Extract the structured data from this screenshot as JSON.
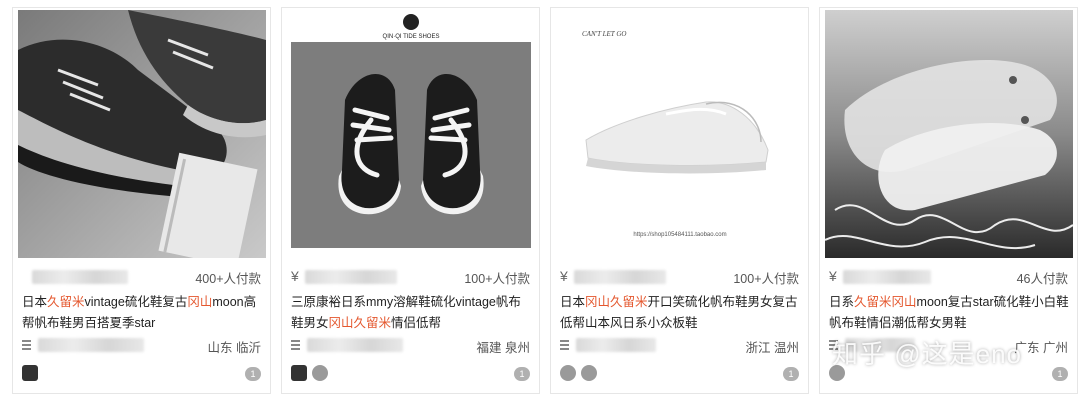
{
  "products": [
    {
      "title_parts": [
        "日本",
        "久留米",
        "vintage硫化鞋复古",
        "冈山",
        "moon高帮帆布鞋男百搭夏季star"
      ],
      "highlight": [
        false,
        true,
        false,
        true,
        false
      ],
      "show_yen": false,
      "sales": "400+人付款",
      "location": "山东 临沂",
      "comment_count": "1"
    },
    {
      "title_parts": [
        "三原康裕日系mmy溶解鞋硫化vintage帆布鞋男女",
        "冈山久留米",
        "情侣低帮"
      ],
      "highlight": [
        false,
        true,
        false
      ],
      "show_yen": true,
      "yen": "¥",
      "sales": "100+人付款",
      "location": "福建 泉州",
      "comment_count": "1",
      "image_text": {
        "brand": "QIN·QI TIDE SHOES"
      }
    },
    {
      "title_parts": [
        "日本",
        "冈山久留米",
        "开口笑硫化帆布鞋男女复古低帮山本风日系小众板鞋"
      ],
      "highlight": [
        false,
        true,
        false
      ],
      "show_yen": true,
      "yen": "¥",
      "sales": "100+人付款",
      "location": "浙江 温州",
      "comment_count": "1",
      "image_text": {
        "caption": "CAN'T LET GO",
        "url": "https://shop105484111.taobao.com"
      }
    },
    {
      "title_parts": [
        "日系",
        "久留米冈山",
        "moon复古star硫化鞋小白鞋帆布鞋情侣潮低帮女男鞋"
      ],
      "highlight": [
        false,
        true,
        false
      ],
      "show_yen": true,
      "yen": "¥",
      "sales": "46人付款",
      "location": "广东 广州",
      "comment_count": "1"
    }
  ],
  "watermark": "知乎 @这是eno",
  "colors": {
    "highlight": "#e4572e",
    "text": "#222222",
    "muted": "#555555",
    "border": "#e6e6e6"
  }
}
